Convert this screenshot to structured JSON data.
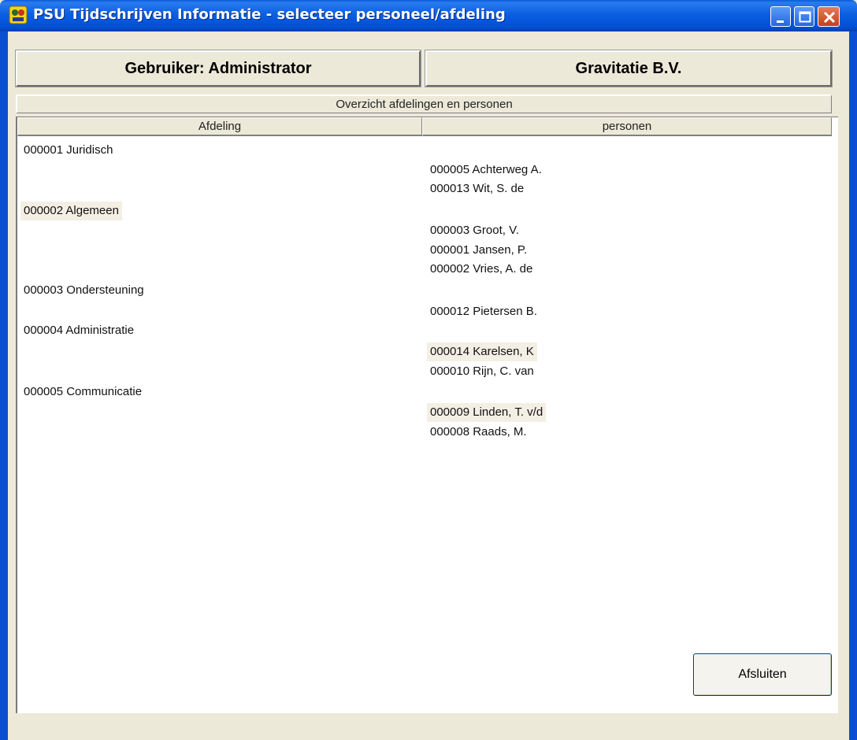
{
  "window": {
    "title": "PSU Tijdschrijven Informatie - selecteer personeel/afdeling"
  },
  "header": {
    "user_label": "Gebruiker: Administrator",
    "company_label": "Gravitatie B.V."
  },
  "overview": {
    "title": "Overzicht afdelingen en personen",
    "columns": [
      "Afdeling",
      "personen"
    ]
  },
  "departments": [
    {
      "label": "000001  Juridisch",
      "persons": [
        "000005  Achterweg A.",
        "000013  Wit, S. de"
      ]
    },
    {
      "label": "000002  Algemeen",
      "persons": [
        "000003  Groot, V.",
        "000001  Jansen, P.",
        "000002  Vries, A. de"
      ]
    },
    {
      "label": "000003  Ondersteuning",
      "persons": [
        "000012  Pietersen B."
      ]
    },
    {
      "label": "000004  Administratie",
      "persons": [
        "000014  Karelsen, K",
        "000010  Rijn, C. van"
      ]
    },
    {
      "label": "000005  Communicatie",
      "persons": [
        "000009  Linden, T. v/d",
        "000008  Raads, M."
      ]
    }
  ],
  "footer": {
    "close_label": "Afsluiten"
  },
  "colors": {
    "titlebar": "#0050d8",
    "window_bg": "#ece9d8",
    "row_highlight": "#f4efe4"
  }
}
